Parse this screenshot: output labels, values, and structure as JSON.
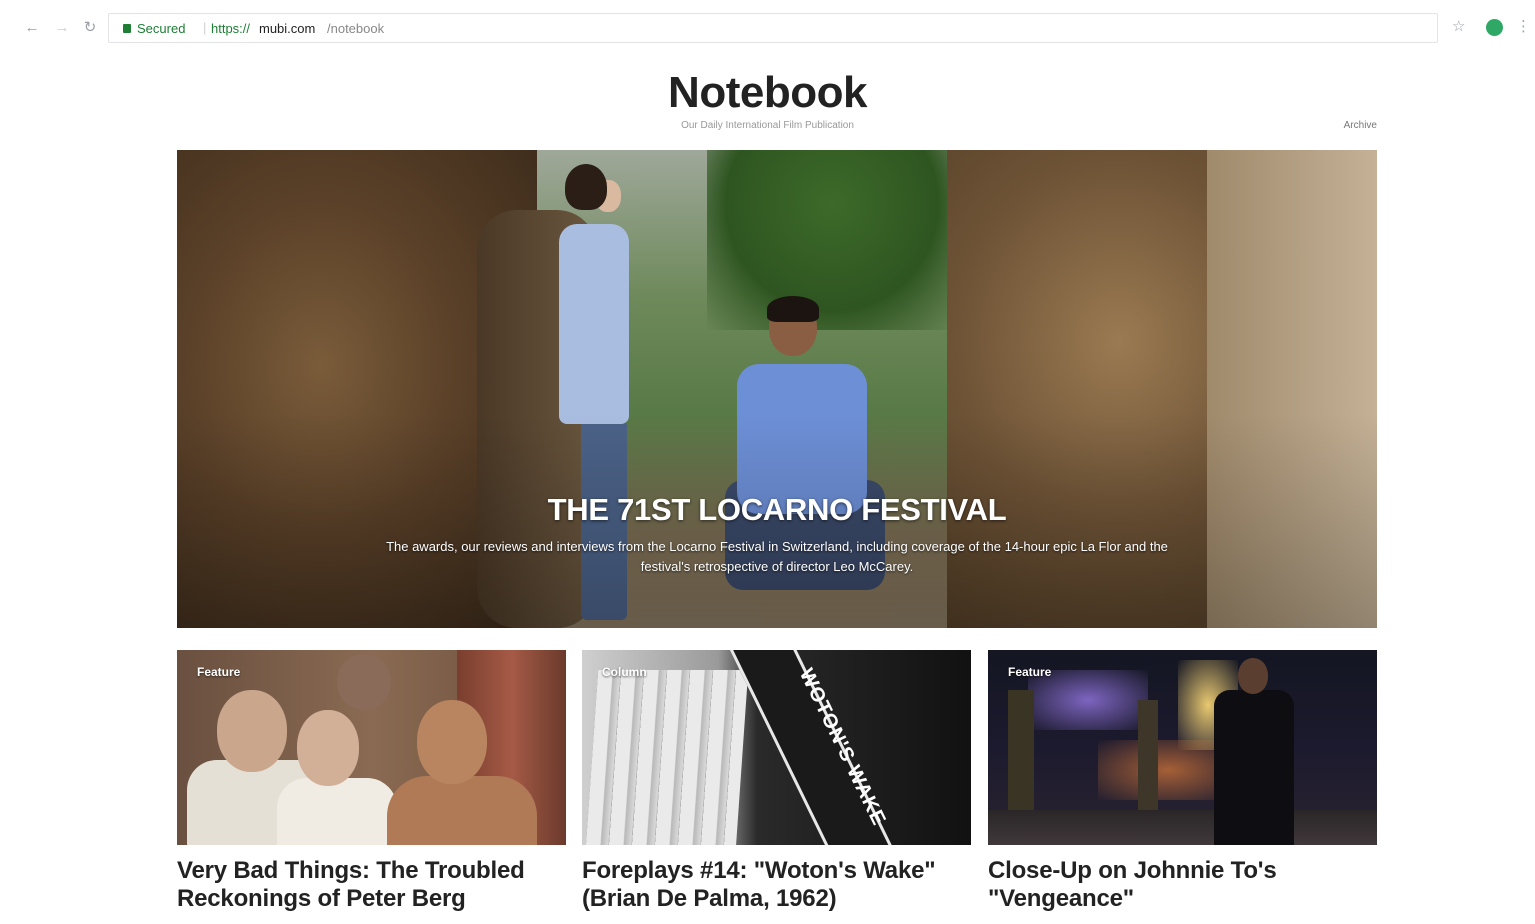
{
  "browser": {
    "secure_label": "Secured",
    "url_scheme": "https://",
    "url_host": "mubi.com",
    "url_path": "/notebook",
    "back_glyph": "←",
    "forward_glyph": "→",
    "reload_glyph": "↻",
    "star_glyph": "☆",
    "menu_glyph": "⋮"
  },
  "header": {
    "title": "Notebook",
    "tagline": "Our Daily International Film Publication",
    "link": "Archive"
  },
  "hero": {
    "title": "THE 71ST LOCARNO FESTIVAL",
    "description": "The awards, our reviews and interviews from the Locarno Festival in Switzerland, including coverage of the 14-hour epic La Flor and the festival's retrospective of director Leo McCarey."
  },
  "cards": [
    {
      "tag": "Feature",
      "title": "Very Bad Things: The Troubled Reckonings of Peter Berg",
      "excerpt": ""
    },
    {
      "tag": "Column",
      "title": "Foreplays #14: \"Woton's Wake\" (Brian De Palma, 1962)",
      "image_text": "WOTON'S WAKE",
      "excerpt": ""
    },
    {
      "tag": "Feature",
      "title": "Close-Up on Johnnie To's \"Vengeance\"",
      "excerpt": ""
    }
  ]
}
